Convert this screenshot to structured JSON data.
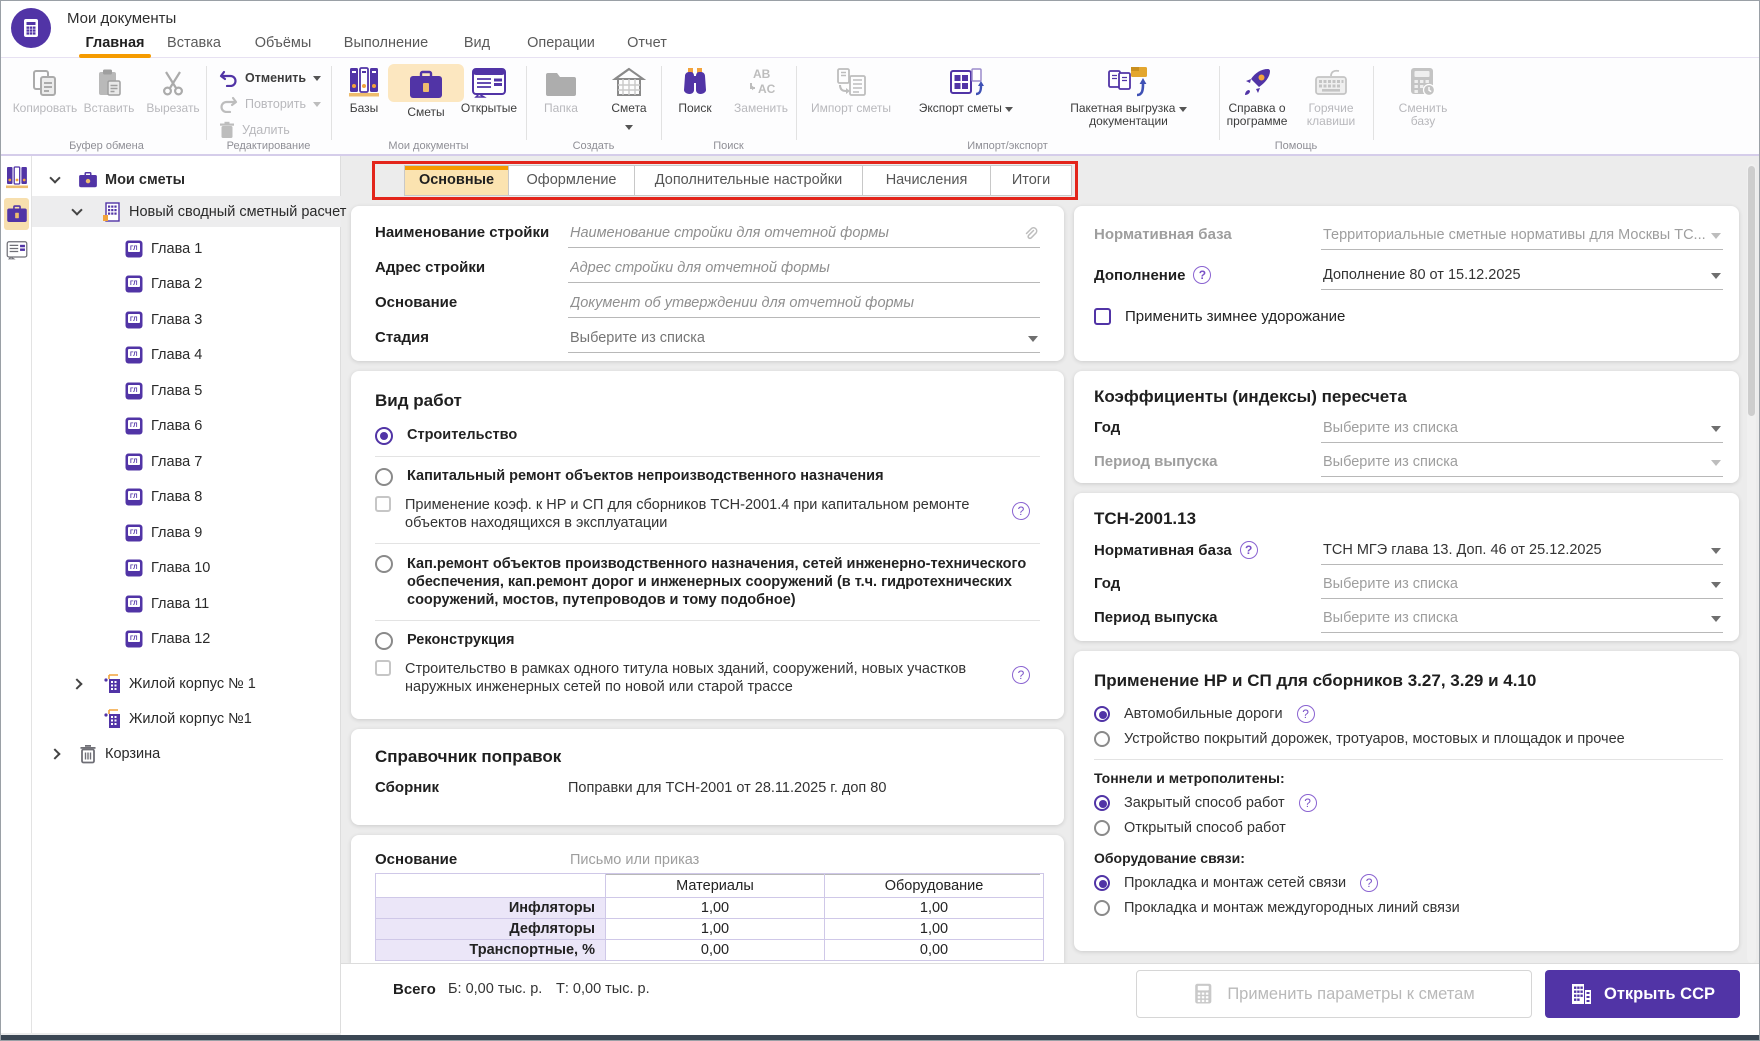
{
  "window": {
    "title": "Мои документы"
  },
  "menu": {
    "tabs": [
      {
        "label": "Главная",
        "active": true
      },
      {
        "label": "Вставка"
      },
      {
        "label": "Объёмы"
      },
      {
        "label": "Выполнение"
      },
      {
        "label": "Вид"
      },
      {
        "label": "Операции"
      },
      {
        "label": "Отчет"
      }
    ]
  },
  "ribbon": {
    "clipboard": {
      "label": "Буфер обмена",
      "copy": "Копировать",
      "paste": "Вставить",
      "cut": "Вырезать"
    },
    "editing": {
      "label": "Редактирование",
      "undo": "Отменить",
      "redo": "Повторить",
      "delete": "Удалить"
    },
    "mydocs": {
      "label": "Мои документы",
      "bases": "Базы",
      "estimates": "Сметы",
      "open": "Открытые"
    },
    "create": {
      "label": "Создать",
      "folder": "Папка",
      "estimate": "Смета"
    },
    "search": {
      "label": "Поиск",
      "find": "Поиск",
      "replace": "Заменить"
    },
    "import_export": {
      "label": "Импорт/экспорт",
      "import": "Импорт сметы",
      "export": "Экспорт сметы",
      "batch_line1": "Пакетная выгрузка",
      "batch_line2": "документации"
    },
    "help": {
      "label": "Помощь",
      "about_line1": "Справка о",
      "about_line2": "программе",
      "hotkeys_line1": "Горячие",
      "hotkeys_line2": "клавиши"
    },
    "change_base": {
      "line1": "Сменить",
      "line2": "базу"
    }
  },
  "tree": {
    "items": [
      {
        "label": "Мои сметы",
        "level": 1,
        "icon": "briefcase",
        "chevron": "down",
        "bold": true
      },
      {
        "label": "Новый сводный сметный расчет",
        "level": 2,
        "icon": "building",
        "chevron": "down",
        "selected": true
      },
      {
        "label": "Глава 1",
        "level": 3,
        "icon": "chapter"
      },
      {
        "label": "Глава 2",
        "level": 3,
        "icon": "chapter"
      },
      {
        "label": "Глава 3",
        "level": 3,
        "icon": "chapter"
      },
      {
        "label": "Глава 4",
        "level": 3,
        "icon": "chapter"
      },
      {
        "label": "Глава 5",
        "level": 3,
        "icon": "chapter"
      },
      {
        "label": "Глава 6",
        "level": 3,
        "icon": "chapter"
      },
      {
        "label": "Глава 7",
        "level": 3,
        "icon": "chapter"
      },
      {
        "label": "Глава 8",
        "level": 3,
        "icon": "chapter"
      },
      {
        "label": "Глава 9",
        "level": 3,
        "icon": "chapter"
      },
      {
        "label": "Глава 10",
        "level": 3,
        "icon": "chapter"
      },
      {
        "label": "Глава 11",
        "level": 3,
        "icon": "chapter"
      },
      {
        "label": "Глава 12",
        "level": 3,
        "icon": "chapter"
      },
      {
        "label": "Жилой корпус № 1",
        "level": 2,
        "icon": "crane",
        "chevron": "right"
      },
      {
        "label": "Жилой корпус №1",
        "level": 2,
        "icon": "crane"
      },
      {
        "label": "Корзина",
        "level": 1,
        "icon": "trash",
        "chevron": "right"
      }
    ]
  },
  "doc_tabs": [
    {
      "label": "Основные",
      "active": true
    },
    {
      "label": "Оформление"
    },
    {
      "label": "Дополнительные настройки"
    },
    {
      "label": "Начисления"
    },
    {
      "label": "Итоги"
    }
  ],
  "form": {
    "construction_name": {
      "label": "Наименование стройки",
      "placeholder": "Наименование стройки для отчетной формы"
    },
    "construction_address": {
      "label": "Адрес стройки",
      "placeholder": "Адрес стройки для отчетной формы"
    },
    "basis": {
      "label": "Основание",
      "placeholder": "Документ об утверждении для отчетной формы"
    },
    "stage": {
      "label": "Стадия",
      "value": "Выберите из списка"
    },
    "work_type": {
      "title": "Вид работ",
      "option1": "Строительство",
      "option2": "Капитальный ремонт объектов непроизводственного назначения",
      "checkbox1": "Применение коэф. к НР и СП для сборников ТСН-2001.4 при капитальном ремонте объектов находящихся в эксплуатации",
      "option3": "Кап.ремонт объектов производственного назначения, сетей инженерно-технического обеспечения, кап.ремонт дорог и инженерных сооружений (в т.ч. гидротехнических сооружений, мостов, путепроводов и тому подобное)",
      "option4": "Реконструкция",
      "checkbox2": "Строительство в рамках одного титула новых зданий, сооружений, новых участков наружных инженерных сетей по новой или старой трассе"
    },
    "corrections": {
      "title": "Справочник поправок",
      "collection_label": "Сборник",
      "collection_value": "Поправки для ТСН-2001 от 28.11.2025 г. доп 80"
    },
    "basis2": {
      "label": "Основание",
      "placeholder": "Письмо или приказ"
    },
    "table": {
      "col_materials": "Материалы",
      "col_equipment": "Оборудование",
      "rows": [
        {
          "label": "Инфляторы",
          "materials": "1,00",
          "equipment": "1,00"
        },
        {
          "label": "Дефляторы",
          "materials": "1,00",
          "equipment": "1,00"
        },
        {
          "label": "Транспортные, %",
          "materials": "0,00",
          "equipment": "0,00"
        }
      ]
    }
  },
  "right": {
    "base": {
      "normative_label": "Нормативная база",
      "normative_value": "Территориальные сметные нормативы для Москвы ТС...",
      "addition_label": "Дополнение",
      "addition_value": "Дополнение 80 от 15.12.2025",
      "winter_checkbox": "Применить зимнее удорожание"
    },
    "indexes": {
      "title": "Коэффициенты (индексы) пересчета",
      "year_label": "Год",
      "year_value": "Выберите из списка",
      "period_label": "Период выпуска",
      "period_value": "Выберите из списка"
    },
    "tsn": {
      "title": "ТСН-2001.13",
      "normative_label": "Нормативная база",
      "normative_value": "ТСН МГЭ глава 13. Доп. 46 от 25.12.2025",
      "year_label": "Год",
      "year_value": "Выберите из списка",
      "period_label": "Период выпуска",
      "period_value": "Выберите из списка"
    },
    "nr_sp": {
      "title": "Применение НР и СП для сборников 3.27, 3.29 и 4.10",
      "roads_option1": "Автомобильные дороги",
      "roads_option2": "Устройство покрытий дорожек, тротуаров, мостовых и площадок и прочее",
      "tunnels_title": "Тоннели и метрополитены:",
      "tunnels_option1": "Закрытый способ работ",
      "tunnels_option2": "Открытый способ работ",
      "comm_title": "Оборудование связи:",
      "comm_option1": "Прокладка и монтаж сетей связи",
      "comm_option2": "Прокладка и монтаж междугородных линий связи"
    }
  },
  "footer": {
    "total_label": "Всего",
    "base_total": "Б: 0,00 тыс. р.",
    "current_total": "Т: 0,00 тыс. р.",
    "apply_button": "Применить параметры к сметам",
    "open_button": "Открыть ССР"
  }
}
